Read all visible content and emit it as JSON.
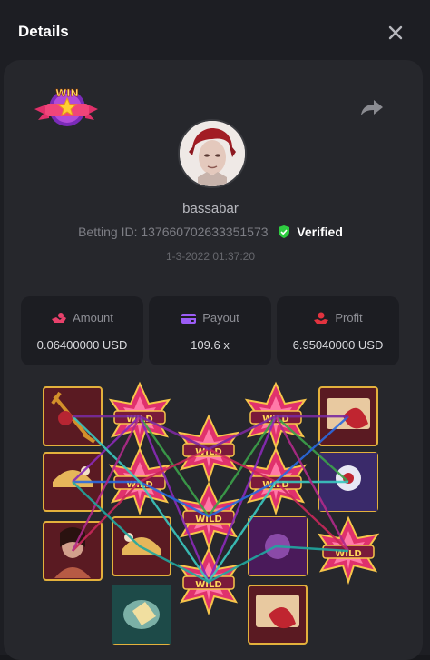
{
  "header": {
    "title": "Details"
  },
  "player": {
    "username": "bassabar",
    "betting_id_label": "Betting ID:",
    "betting_id": "137660702633351573",
    "verified_label": "Verified",
    "datetime": "1-3-2022 01:37:20"
  },
  "stats": [
    {
      "label": "Amount",
      "value": "0.06400000 USD",
      "icon": "coins-icon"
    },
    {
      "label": "Payout",
      "value": "109.6 x",
      "icon": "wallet-icon"
    },
    {
      "label": "Profit",
      "value": "6.95040000 USD",
      "icon": "profit-icon"
    }
  ],
  "badge": {
    "text": "WIN"
  },
  "wild_text": "WILD",
  "colors": {
    "verified": "#2ecc40",
    "amount_icon": "#e8416b",
    "payout_icon": "#9b5cf6",
    "profit_icon": "#e2333f"
  }
}
